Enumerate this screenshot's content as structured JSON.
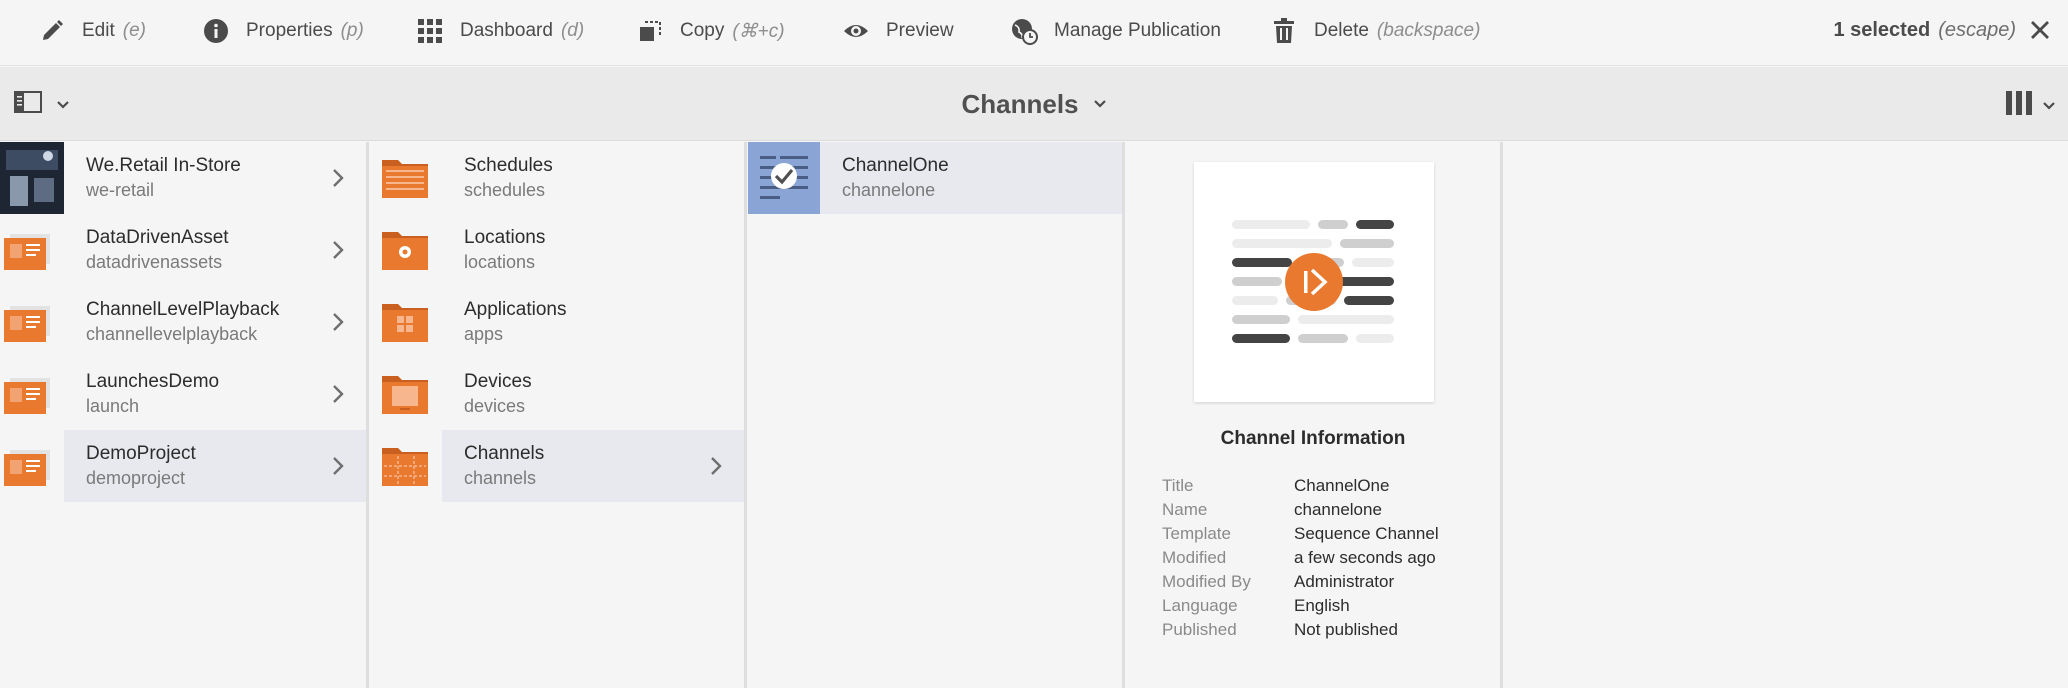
{
  "toolbar": {
    "edit": {
      "label": "Edit",
      "hint": "(e)"
    },
    "properties": {
      "label": "Properties",
      "hint": "(p)"
    },
    "dashboard": {
      "label": "Dashboard",
      "hint": "(d)"
    },
    "copy": {
      "label": "Copy",
      "hint": "(⌘+c)"
    },
    "preview": {
      "label": "Preview"
    },
    "manage_publication": {
      "label": "Manage Publication"
    },
    "delete": {
      "label": "Delete",
      "hint": "(backspace)"
    },
    "selection": {
      "label": "1 selected",
      "hint": "(escape)"
    }
  },
  "subbar": {
    "title": "Channels"
  },
  "columns": {
    "projects": [
      {
        "title": "We.Retail In-Store",
        "sub": "we-retail"
      },
      {
        "title": "DataDrivenAsset",
        "sub": "datadrivenassets"
      },
      {
        "title": "ChannelLevelPlayback",
        "sub": "channellevelplayback"
      },
      {
        "title": "LaunchesDemo",
        "sub": "launch"
      },
      {
        "title": "DemoProject",
        "sub": "demoproject"
      }
    ],
    "folders": [
      {
        "title": "Schedules",
        "sub": "schedules"
      },
      {
        "title": "Locations",
        "sub": "locations"
      },
      {
        "title": "Applications",
        "sub": "apps"
      },
      {
        "title": "Devices",
        "sub": "devices"
      },
      {
        "title": "Channels",
        "sub": "channels"
      }
    ],
    "channels": [
      {
        "title": "ChannelOne",
        "sub": "channelone"
      }
    ]
  },
  "info": {
    "heading": "Channel Information",
    "rows": [
      {
        "key": "Title",
        "value": "ChannelOne"
      },
      {
        "key": "Name",
        "value": "channelone"
      },
      {
        "key": "Template",
        "value": "Sequence Channel"
      },
      {
        "key": "Modified",
        "value": "a few seconds ago"
      },
      {
        "key": "Modified By",
        "value": "Administrator"
      },
      {
        "key": "Language",
        "value": "English"
      },
      {
        "key": "Published",
        "value": "Not published"
      }
    ]
  },
  "colors": {
    "accent": "#e8792f",
    "selected_row": "#e7e9ef",
    "thumb_selected": "#7f9bd0"
  },
  "icons": [
    "pencil-icon",
    "info-icon",
    "grid-icon",
    "copy-icon",
    "eye-icon",
    "globe-clock-icon",
    "trash-icon",
    "close-icon",
    "rail-icon",
    "chevron-down-icon",
    "column-view-icon",
    "chevron-right-icon",
    "folder-icon",
    "checkmark-icon",
    "play-icon"
  ]
}
